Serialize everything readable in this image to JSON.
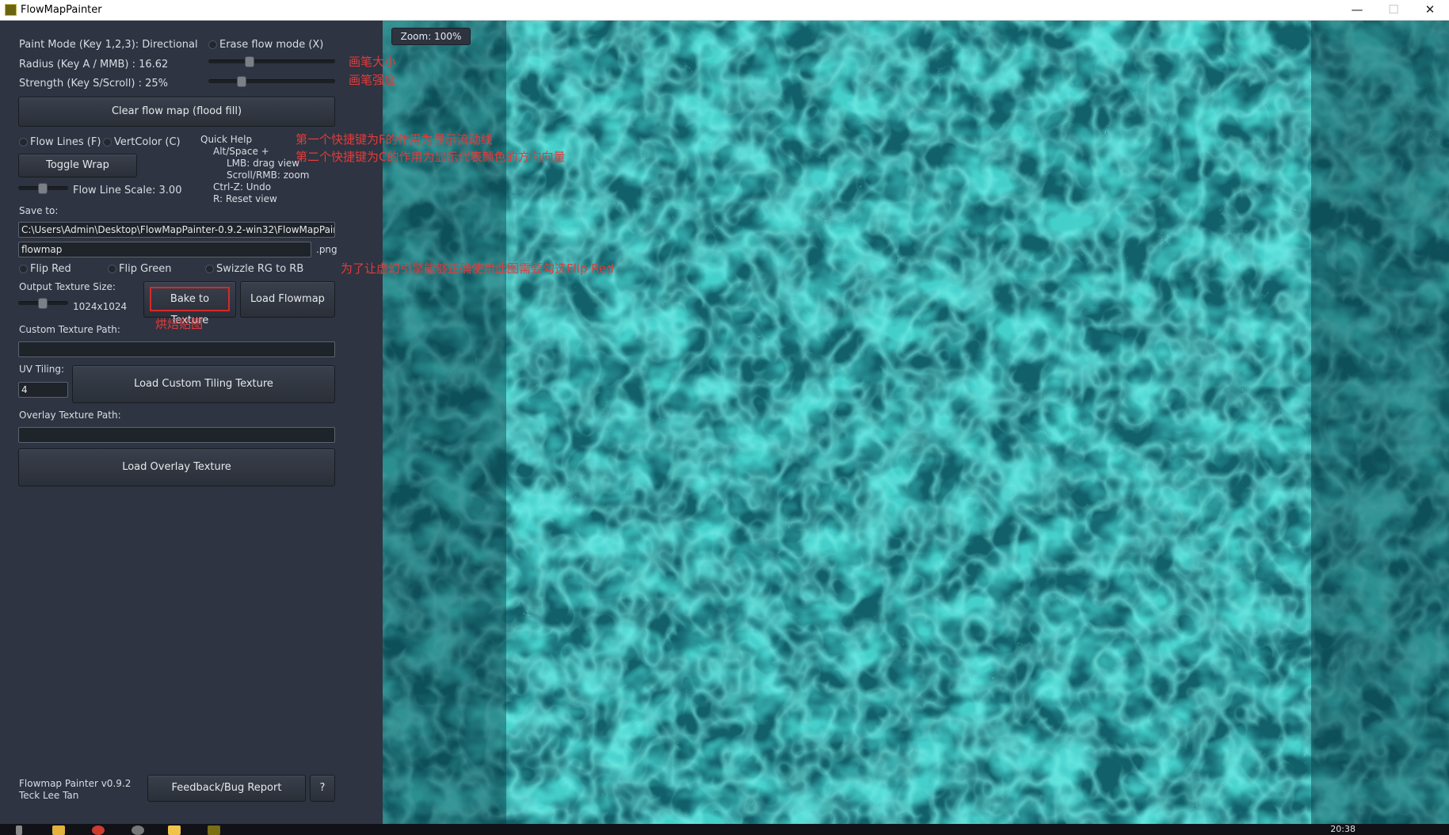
{
  "window": {
    "title": "FlowMapPainter",
    "controls": {
      "minimize": "—",
      "maximize": "☐",
      "close": "✕"
    }
  },
  "sidebar": {
    "paint_mode_label": "Paint Mode (Key 1,2,3): Directional",
    "erase_flow_label": "Erase flow mode (X)",
    "radius_label": "Radius (Key A / MMB) : 16.62",
    "radius_value": 0.33,
    "strength_label": "Strength (Key S/Scroll) : 25%",
    "strength_value": 0.25,
    "clear_button": "Clear flow map (flood fill)",
    "flow_lines_label": "Flow Lines (F)",
    "vertcolor_label": "VertColor (C)",
    "toggle_wrap_button": "Toggle Wrap",
    "flow_line_scale_label": "Flow Line Scale: 3.00",
    "flow_line_scale_value": 0.3,
    "quick_help": {
      "title": "Quick Help",
      "line1": "Alt/Space +",
      "line2": "LMB: drag view",
      "line3": "Scroll/RMB: zoom",
      "line4": "Ctrl-Z: Undo",
      "line5": "R: Reset view"
    },
    "save_to_label": "Save to:",
    "save_path": "C:\\Users\\Admin\\Desktop\\FlowMapPainter-0.9.2-win32\\FlowMapPain",
    "file_name": "flowmap",
    "file_ext": ".png",
    "flip_red_label": "Flip Red",
    "flip_green_label": "Flip Green",
    "swizzle_label": "Swizzle RG to RB",
    "output_size_label": "Output Texture Size:",
    "output_size_value": "1024x1024",
    "output_size_slider": 0.5,
    "bake_button": "Bake to Texture",
    "load_flowmap_button": "Load Flowmap",
    "custom_texture_label": "Custom Texture Path:",
    "custom_texture_value": "",
    "uv_tiling_label": "UV Tiling:",
    "uv_tiling_value": "4",
    "load_custom_button": "Load Custom Tiling Texture",
    "overlay_label": "Overlay Texture Path:",
    "overlay_value": "",
    "load_overlay_button": "Load Overlay Texture",
    "footer_version": "Flowmap Painter v0.9.2",
    "footer_author": "Teck Lee Tan",
    "feedback_button": "Feedback/Bug Report",
    "help_button": "?"
  },
  "annotations": {
    "brush_size": "画笔大小",
    "brush_strength": "画笔强度",
    "hotkey_f": "第一个快捷键为F的作用为显示流动线",
    "hotkey_c": "第二个快捷键为C的作用为显示代表颜色的方向向量",
    "flip_red_note": "为了让虚幻引擎能够正确使用此图需要勾选Flip Red",
    "bake_note": "烘焙贴图"
  },
  "viewport": {
    "zoom_label": "Zoom: 100%"
  },
  "taskbar": {
    "clock": "20:38"
  },
  "colors": {
    "panel_bg": "#2e3441",
    "water_dark": "#0f5a63",
    "water_light": "#54e6e0",
    "annotation": "#e43b3b"
  }
}
